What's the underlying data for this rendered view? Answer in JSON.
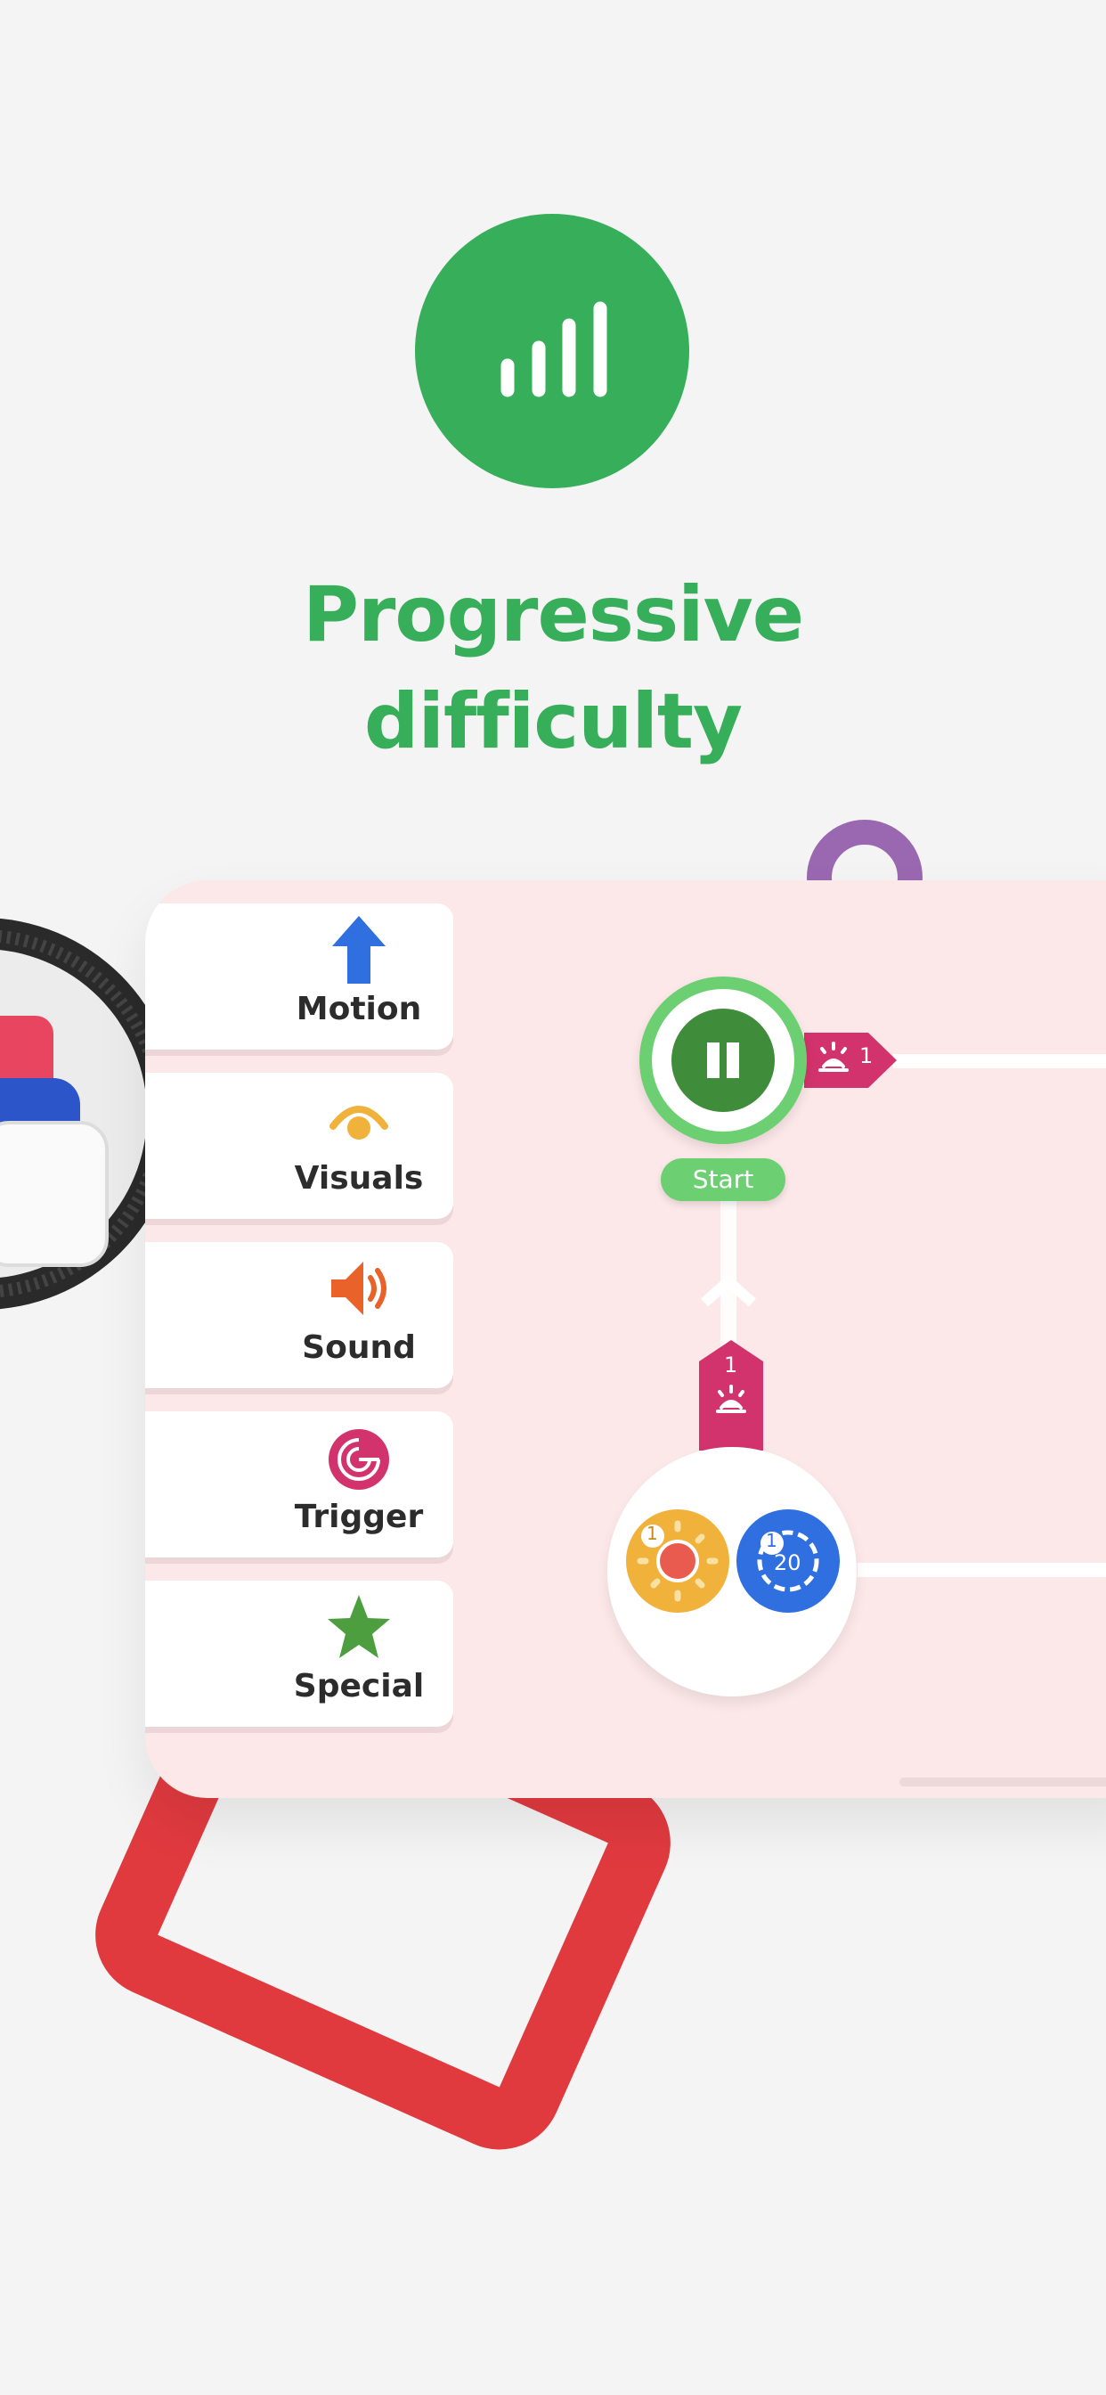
{
  "header": {
    "icon": "signal-bars-icon",
    "title_line1": "Progressive",
    "title_line2": "difficulty",
    "accent": "#37ae5a"
  },
  "categories": [
    {
      "label": "Motion",
      "icon": "up-arrow-icon",
      "color": "#2f6fe0"
    },
    {
      "label": "Visuals",
      "icon": "eye-light-icon",
      "color": "#f0b23a"
    },
    {
      "label": "Sound",
      "icon": "speaker-icon",
      "color": "#e8622a"
    },
    {
      "label": "Trigger",
      "icon": "radar-icon",
      "color": "#d3336c"
    },
    {
      "label": "Special",
      "icon": "star-icon",
      "color": "#4c9e3e"
    }
  ],
  "canvas": {
    "start_label": "Start",
    "start_icon": "pause-icon",
    "tag_right_count": "1",
    "tag_up_count": "1",
    "tag_icon": "alarm-light-icon",
    "tag_color": "#d3336c",
    "node_light_badge": "1",
    "node_gear_badge": "1",
    "node_gear_value": "20"
  }
}
